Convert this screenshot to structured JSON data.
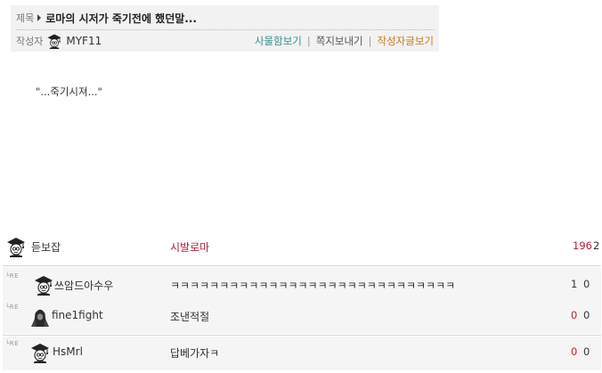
{
  "post": {
    "title_label": "제목",
    "title": "로마의 시저가 죽기전에 했던말...",
    "author_label": "작성자",
    "author": "MYF11",
    "body": "\"...죽기시져...\""
  },
  "actions": {
    "inbox": "사물함보기",
    "send_message": "쪽지보내기",
    "author_posts": "작성자글보기",
    "separator": "|"
  },
  "colors": {
    "inbox": "#3c8c8c",
    "send_message": "#555555",
    "author_posts": "#cc7a1e",
    "comment_highlight": "#b0203a",
    "count_red": "#cc2020"
  },
  "comments": [
    {
      "reply_marker": "",
      "name": "듣보잡",
      "text": "시발로마",
      "count1": "196",
      "count2": "2",
      "avatar": "graduate-cap-icon"
    },
    {
      "reply_marker": "└RE",
      "name": "쓰암드아수우",
      "text": "ㅋㅋㅋㅋㅋㅋㅋㅋㅋㅋㅋㅋㅋㅋㅋㅋㅋㅋㅋㅋㅋㅋㅋㅋㅋㅋㅋㅋㅋ",
      "count1": "1",
      "count2": "0",
      "avatar": "graduate-cap-icon"
    },
    {
      "reply_marker": "└RE",
      "name": "fine1fight",
      "text": "조낸적절",
      "count1": "0",
      "count2": "0",
      "avatar": "hooded-figure-icon"
    },
    {
      "reply_marker": "└RE",
      "name": "HsMrl",
      "text": "답베가자ㅋ",
      "count1": "0",
      "count2": "0",
      "avatar": "graduate-cap-icon"
    }
  ]
}
